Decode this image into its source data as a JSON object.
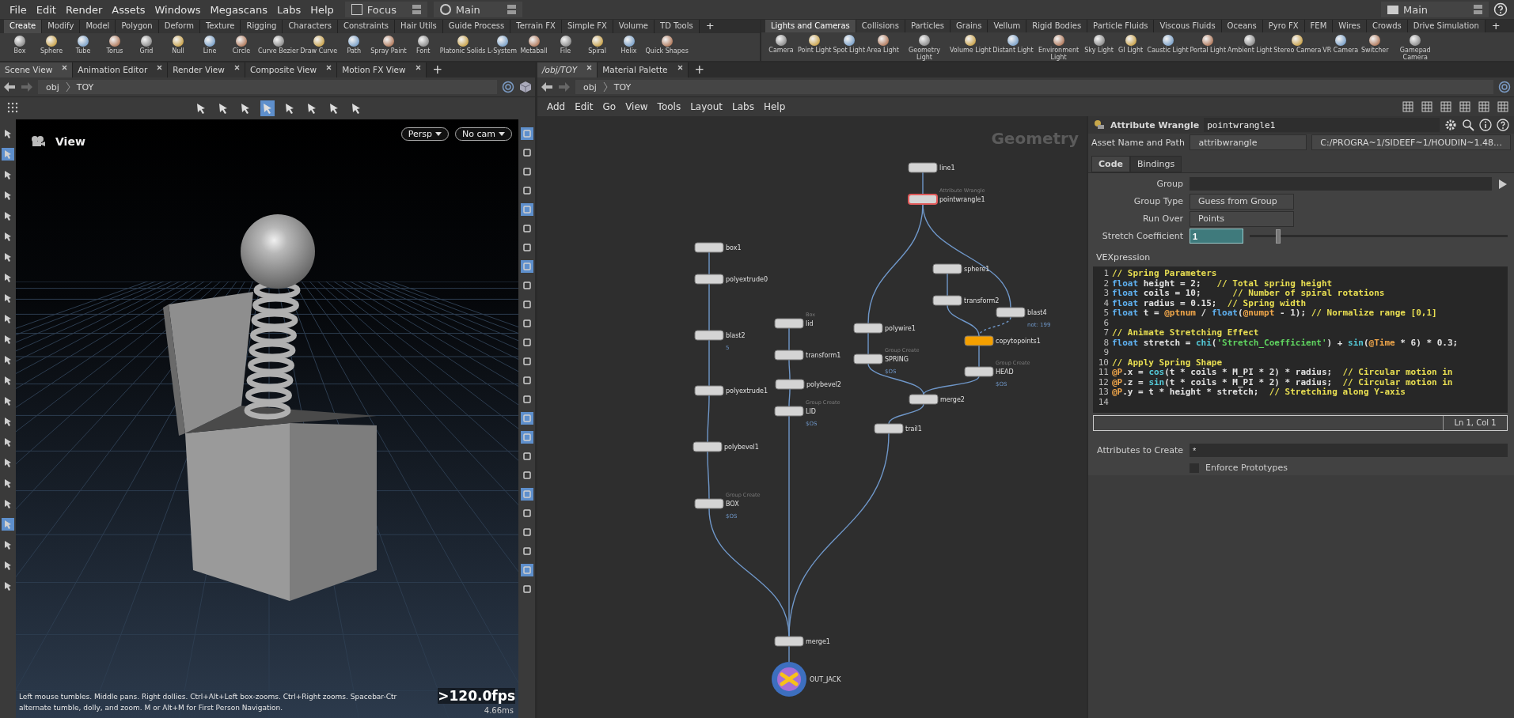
{
  "menu": {
    "items": [
      "File",
      "Edit",
      "Render",
      "Assets",
      "Windows",
      "Megascans",
      "Labs",
      "Help"
    ],
    "desktop": "Focus",
    "layout": "Main",
    "right_layout": "Main"
  },
  "shelf_left": {
    "tabs": [
      {
        "label": "Create",
        "selected": true
      },
      {
        "label": "Modify",
        "selected": false
      },
      {
        "label": "Model",
        "selected": false
      },
      {
        "label": "Polygon",
        "selected": false
      },
      {
        "label": "Deform",
        "selected": false
      },
      {
        "label": "Texture",
        "selected": false
      },
      {
        "label": "Rigging",
        "selected": false
      },
      {
        "label": "Characters",
        "selected": false
      },
      {
        "label": "Constraints",
        "selected": false
      },
      {
        "label": "Hair Utils",
        "selected": false
      },
      {
        "label": "Guide Process",
        "selected": false
      },
      {
        "label": "Terrain FX",
        "selected": false
      },
      {
        "label": "Simple FX",
        "selected": false
      },
      {
        "label": "Volume",
        "selected": false
      },
      {
        "label": "TD Tools",
        "selected": false
      }
    ],
    "add": "+",
    "tools": [
      "Box",
      "Sphere",
      "Tube",
      "Torus",
      "Grid",
      "Null",
      "Line",
      "Circle",
      "Curve Bezier",
      "Draw Curve",
      "Path",
      "Spray Paint",
      "Font",
      "Platonic Solids",
      "L-System",
      "Metaball",
      "File",
      "Spiral",
      "Helix",
      "Quick Shapes"
    ]
  },
  "shelf_right": {
    "tabs": [
      {
        "label": "Lights and Cameras",
        "selected": true
      },
      {
        "label": "Collisions",
        "selected": false
      },
      {
        "label": "Particles",
        "selected": false
      },
      {
        "label": "Grains",
        "selected": false
      },
      {
        "label": "Vellum",
        "selected": false
      },
      {
        "label": "Rigid Bodies",
        "selected": false
      },
      {
        "label": "Particle Fluids",
        "selected": false
      },
      {
        "label": "Viscous Fluids",
        "selected": false
      },
      {
        "label": "Oceans",
        "selected": false
      },
      {
        "label": "Pyro FX",
        "selected": false
      },
      {
        "label": "FEM",
        "selected": false
      },
      {
        "label": "Wires",
        "selected": false
      },
      {
        "label": "Crowds",
        "selected": false
      },
      {
        "label": "Drive Simulation",
        "selected": false
      }
    ],
    "add": "+",
    "tools": [
      "Camera",
      "Point Light",
      "Spot Light",
      "Area Light",
      "Geometry Light",
      "Volume Light",
      "Distant Light",
      "Environment Light",
      "Sky Light",
      "GI Light",
      "Caustic Light",
      "Portal Light",
      "Ambient Light",
      "Stereo Camera",
      "VR Camera",
      "Switcher",
      "Gamepad Camera"
    ]
  },
  "left_pane": {
    "tabs": [
      {
        "label": "Scene View",
        "selected": true
      },
      {
        "label": "Animation Editor",
        "selected": false
      },
      {
        "label": "Render View",
        "selected": false
      },
      {
        "label": "Composite View",
        "selected": false
      },
      {
        "label": "Motion FX View",
        "selected": false
      }
    ],
    "add": "+",
    "path": [
      "obj",
      "TOY"
    ],
    "toolbar": [
      {
        "selected": false
      },
      {
        "selected": false
      },
      {
        "selected": false
      },
      {
        "selected": true
      },
      {
        "selected": false
      },
      {
        "selected": false
      },
      {
        "selected": false
      },
      {
        "selected": false
      }
    ],
    "side_tools": [
      {
        "selected": false
      },
      {
        "selected": true
      },
      {
        "selected": false
      },
      {
        "selected": false
      },
      {
        "selected": false
      },
      {
        "selected": false
      },
      {
        "selected": false
      },
      {
        "selected": false
      },
      {
        "selected": false
      },
      {
        "selected": false
      },
      {
        "selected": false
      },
      {
        "selected": false
      },
      {
        "selected": false
      },
      {
        "selected": false
      },
      {
        "selected": false
      },
      {
        "selected": false
      },
      {
        "selected": false
      },
      {
        "selected": false
      },
      {
        "selected": false
      },
      {
        "selected": true
      },
      {
        "selected": false
      },
      {
        "selected": false
      },
      {
        "selected": false
      }
    ],
    "right_tools": [
      {
        "selected": true
      },
      {
        "selected": false
      },
      {
        "selected": false
      },
      {
        "selected": false
      },
      {
        "selected": true
      },
      {
        "selected": false
      },
      {
        "selected": false
      },
      {
        "selected": true
      },
      {
        "selected": false
      },
      {
        "selected": false
      },
      {
        "selected": false
      },
      {
        "selected": false
      },
      {
        "selected": false
      },
      {
        "selected": false
      },
      {
        "selected": false
      },
      {
        "selected": true
      },
      {
        "selected": true
      },
      {
        "selected": false
      },
      {
        "selected": false
      },
      {
        "selected": true
      },
      {
        "selected": false
      },
      {
        "selected": false
      },
      {
        "selected": false
      },
      {
        "selected": true
      },
      {
        "selected": false
      }
    ],
    "viewport": {
      "title": "View",
      "projection": "Persp",
      "camera": "No cam",
      "help_line_1": "Left mouse tumbles. Middle pans. Right dollies. Ctrl+Alt+Left box-zooms. Ctrl+Right zooms. Spacebar-Ctr",
      "help_line_2": "alternate tumble, dolly, and zoom. M or Alt+M for First Person Navigation.",
      "fps": ">120.0fps",
      "frame_time": "4.66ms"
    }
  },
  "right_pane": {
    "tabs": [
      {
        "label": "/obj/TOY",
        "selected": true
      },
      {
        "label": "Material Palette",
        "selected": false
      }
    ],
    "add": "+",
    "path": [
      "obj",
      "TOY"
    ],
    "menu": [
      "Add",
      "Edit",
      "Go",
      "View",
      "Tools",
      "Layout",
      "Labs",
      "Help"
    ],
    "network": {
      "context": "Geometry",
      "nodes": [
        {
          "name": "line1",
          "kind": "op",
          "color": "#d4d4d4",
          "selected": false
        },
        {
          "name": "pointwrangle1",
          "type": "Attribute Wrangle",
          "kind": "op",
          "color": "#d4d4d4",
          "selected": true
        },
        {
          "name": "box1",
          "kind": "op",
          "color": "#d4d4d4",
          "selected": false
        },
        {
          "name": "polyextrude0",
          "kind": "op",
          "color": "#d4d4d4",
          "selected": false
        },
        {
          "name": "blast2",
          "comment": "5",
          "kind": "op",
          "color": "#d4d4d4",
          "selected": false
        },
        {
          "name": "polyextrude1",
          "kind": "op",
          "color": "#d4d4d4",
          "selected": false
        },
        {
          "name": "polybevel1",
          "kind": "op",
          "color": "#d4d4d4",
          "selected": false
        },
        {
          "name": "BOX",
          "type": "Group Create",
          "comment": "$OS",
          "kind": "op",
          "color": "#d4d4d4",
          "selected": false
        },
        {
          "name": "lid",
          "type": "Box",
          "kind": "op",
          "color": "#d4d4d4",
          "selected": false
        },
        {
          "name": "transform1",
          "kind": "op",
          "color": "#d4d4d4",
          "selected": false
        },
        {
          "name": "polybevel2",
          "kind": "op",
          "color": "#d4d4d4",
          "selected": false
        },
        {
          "name": "LID",
          "type": "Group Create",
          "comment": "$OS",
          "kind": "op",
          "color": "#d4d4d4",
          "selected": false
        },
        {
          "name": "polywire1",
          "kind": "op",
          "color": "#d4d4d4",
          "selected": false
        },
        {
          "name": "SPRING",
          "type": "Group Create",
          "comment": "$OS",
          "kind": "op",
          "color": "#d4d4d4",
          "selected": false
        },
        {
          "name": "sphere1",
          "kind": "op",
          "color": "#d4d4d4",
          "selected": false
        },
        {
          "name": "transform2",
          "kind": "op",
          "color": "#d4d4d4",
          "selected": false
        },
        {
          "name": "blast4",
          "comment": "not: 199",
          "kind": "op",
          "color": "#d4d4d4",
          "selected": false
        },
        {
          "name": "copytopoints1",
          "kind": "op",
          "color": "#f5a000",
          "selected": false
        },
        {
          "name": "HEAD",
          "type": "Group Create",
          "comment": "$OS",
          "kind": "op",
          "color": "#d4d4d4",
          "selected": false
        },
        {
          "name": "merge2",
          "kind": "op",
          "color": "#d4d4d4",
          "selected": false
        },
        {
          "name": "trail1",
          "kind": "op",
          "color": "#d4d4d4",
          "selected": false
        },
        {
          "name": "merge1",
          "kind": "op",
          "color": "#d4d4d4",
          "selected": false
        },
        {
          "name": "OUT_JACK",
          "kind": "output",
          "color": "#a66fd6",
          "selected": false
        }
      ]
    },
    "parameters": {
      "type": "Attribute Wrangle",
      "node_name": "pointwrangle1",
      "asset_label": "Asset Name and Path",
      "asset_name": "attribwrangle",
      "asset_path": "C:/PROGRA~1/SIDEEF~1/HOUDIN~1.48…",
      "tabs": [
        {
          "label": "Code",
          "selected": true
        },
        {
          "label": "Bindings",
          "selected": false
        }
      ],
      "group_label": "Group",
      "group_type_label": "Group Type",
      "group_type": "Guess from Group",
      "run_over_label": "Run Over",
      "run_over": "Points",
      "stretch_label": "Stretch Coefficient",
      "stretch_value": "1",
      "stretch_slider": {
        "level": 0.1
      },
      "vex_label": "VEXpression",
      "code": [
        {
          "number": "1",
          "segments": [
            {
              "kind": "comment",
              "text": "// Spring Parameters"
            }
          ]
        },
        {
          "number": "2",
          "segments": [
            {
              "kind": "keyword",
              "text": "float"
            },
            {
              "kind": "plain",
              "text": " height = 2;   "
            },
            {
              "kind": "comment",
              "text": "// Total spring height"
            }
          ]
        },
        {
          "number": "3",
          "segments": [
            {
              "kind": "keyword",
              "text": "float"
            },
            {
              "kind": "plain",
              "text": " coils = 10;      "
            },
            {
              "kind": "comment",
              "text": "// Number of spiral rotations"
            }
          ]
        },
        {
          "number": "4",
          "segments": [
            {
              "kind": "keyword",
              "text": "float"
            },
            {
              "kind": "plain",
              "text": " radius = 0.15;  "
            },
            {
              "kind": "comment",
              "text": "// Spring width"
            }
          ]
        },
        {
          "number": "5",
          "segments": [
            {
              "kind": "keyword",
              "text": "float"
            },
            {
              "kind": "plain",
              "text": " t = "
            },
            {
              "kind": "attribute",
              "text": "@ptnum"
            },
            {
              "kind": "plain",
              "text": " / "
            },
            {
              "kind": "keyword",
              "text": "float"
            },
            {
              "kind": "plain",
              "text": "("
            },
            {
              "kind": "attribute",
              "text": "@numpt"
            },
            {
              "kind": "plain",
              "text": " - 1); "
            },
            {
              "kind": "comment",
              "text": "// Normalize range [0,1]"
            }
          ]
        },
        {
          "number": "6"
        },
        {
          "number": "7",
          "segments": [
            {
              "kind": "comment",
              "text": "// Animate Stretching Effect"
            }
          ]
        },
        {
          "number": "8",
          "segments": [
            {
              "kind": "keyword",
              "text": "float"
            },
            {
              "kind": "plain",
              "text": " stretch = "
            },
            {
              "kind": "function",
              "text": "chi"
            },
            {
              "kind": "plain",
              "text": "("
            },
            {
              "kind": "string",
              "text": "'Stretch_Coefficient'"
            },
            {
              "kind": "plain",
              "text": ") + "
            },
            {
              "kind": "function",
              "text": "sin"
            },
            {
              "kind": "plain",
              "text": "("
            },
            {
              "kind": "attribute",
              "text": "@Time"
            },
            {
              "kind": "plain",
              "text": " * 6) * 0.3;"
            }
          ]
        },
        {
          "number": "9"
        },
        {
          "number": "10",
          "segments": [
            {
              "kind": "comment",
              "text": "// Apply Spring Shape"
            }
          ]
        },
        {
          "number": "11",
          "segments": [
            {
              "kind": "attribute",
              "text": "@P"
            },
            {
              "kind": "plain",
              "text": ".x = "
            },
            {
              "kind": "function",
              "text": "cos"
            },
            {
              "kind": "plain",
              "text": "(t * coils * M_PI * 2) * radius;  "
            },
            {
              "kind": "comment",
              "text": "// Circular motion in"
            }
          ]
        },
        {
          "number": "12",
          "segments": [
            {
              "kind": "attribute",
              "text": "@P"
            },
            {
              "kind": "plain",
              "text": ".z = "
            },
            {
              "kind": "function",
              "text": "sin"
            },
            {
              "kind": "plain",
              "text": "(t * coils * M_PI * 2) * radius;  "
            },
            {
              "kind": "comment",
              "text": "// Circular motion in"
            }
          ]
        },
        {
          "number": "13",
          "segments": [
            {
              "kind": "attribute",
              "text": "@P"
            },
            {
              "kind": "plain",
              "text": ".y = t * height * stretch;  "
            },
            {
              "kind": "comment",
              "text": "// Stretching along Y-axis"
            }
          ]
        },
        {
          "number": "14"
        }
      ],
      "cursor": "Ln 1, Col 1",
      "attributes_label": "Attributes to Create",
      "attributes_value": "*",
      "enforce_label": "Enforce Prototypes",
      "enforce_checked": false
    }
  }
}
